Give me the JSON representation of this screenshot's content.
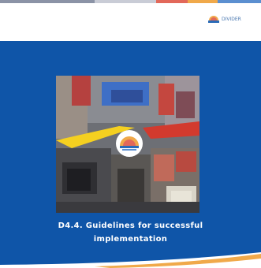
{
  "header": {
    "stripe_colors": [
      "#8b93a6",
      "#c9ccd6",
      "#e2685a",
      "#f0a94a",
      "#5b8fd0"
    ],
    "logo": {
      "icon": "sunrise-emblem-icon",
      "text": "DIVIDER"
    }
  },
  "cover": {
    "background_color": "#0f55a8",
    "photo": {
      "icon": "urban-street-facade-photo",
      "emblem_icon": "sunrise-emblem-icon"
    },
    "title_line1": "D4.4. Guidelines for successful",
    "title_line2": "implementation"
  }
}
